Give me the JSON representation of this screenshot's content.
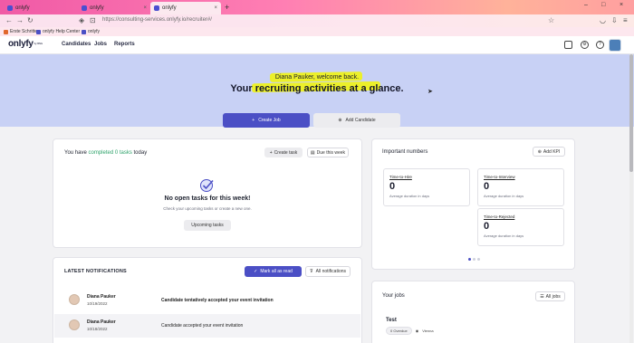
{
  "browser": {
    "tabs": [
      {
        "label": "onlyfy",
        "active": false
      },
      {
        "label": "onlyfy",
        "active": false
      },
      {
        "label": "onlyfy",
        "active": true
      }
    ],
    "new_tab": "+",
    "url": "https://consulting-services.onlyfy.io/recruiter#/",
    "bookmarks": [
      "Erste Schritte",
      "onlyfy Help Center",
      "onlyfy"
    ]
  },
  "header": {
    "logo": "onlyfy",
    "logo_sub": "by XING",
    "nav": [
      "Candidates",
      "Jobs",
      "Reports"
    ]
  },
  "hero": {
    "welcome": "Diana Pauker, welcome back.",
    "headline": "Your recruiting activities at a glance.",
    "create_job": "Create Job",
    "add_candidate": "Add Candidate"
  },
  "tasks": {
    "title_prefix": "You have ",
    "title_highlight": "completed 0 tasks",
    "title_suffix": " today",
    "create_task": "Create task",
    "due_filter": "Due this week",
    "empty_title": "No open tasks for this week!",
    "empty_sub": "Check your upcoming tasks or create a new one.",
    "upcoming": "Upcoming tasks"
  },
  "important": {
    "title": "Important numbers",
    "add_kpi": "Add KPI",
    "kpis": [
      {
        "title": "Time-to-Hire",
        "value": "0",
        "desc": "Average duration in days"
      },
      {
        "title": "Time-to-Interview",
        "value": "0",
        "desc": "Average duration in days"
      },
      {
        "title": "Time-to-Rejected",
        "value": "0",
        "desc": "Average duration in days"
      }
    ]
  },
  "notifications": {
    "title": "LATEST NOTIFICATIONS",
    "mark_all": "Mark all as read",
    "all": "All notifications",
    "items": [
      {
        "name": "Diana Pauker",
        "date": "10/19/2022",
        "text": "Candidate tentatively accepted your event invitation",
        "unread": true
      },
      {
        "name": "Diana Pauker",
        "date": "10/18/2022",
        "text": "Candidate accepted your event invitation",
        "unread": false
      }
    ]
  },
  "jobs": {
    "title": "Your jobs",
    "all_jobs": "All jobs",
    "job_name": "Test",
    "overdue": "0 Overdue",
    "location": "Vienna"
  },
  "colors": {
    "brand": "#4b4fc5",
    "hero_bg": "#c8d1f5",
    "highlight": "#ecf02a",
    "completed": "#2fa36b"
  }
}
